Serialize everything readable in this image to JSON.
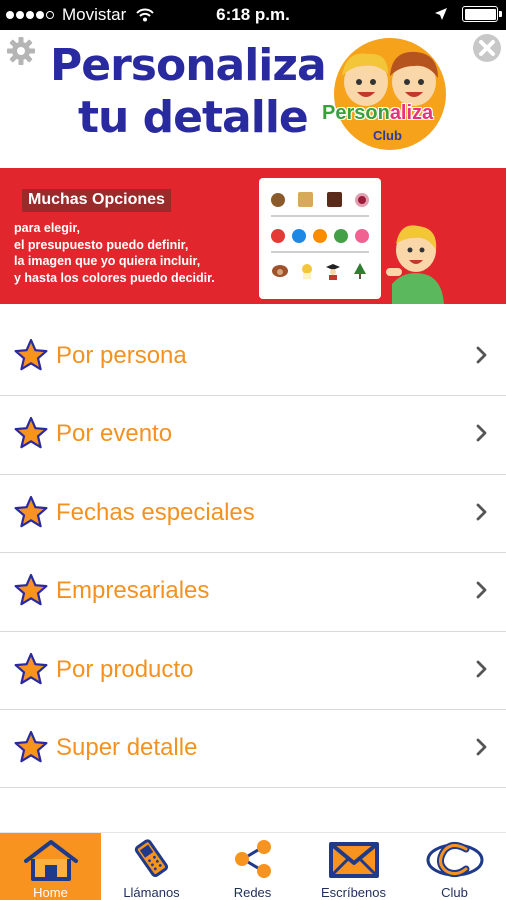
{
  "status_bar": {
    "carrier": "Movistar",
    "time": "6:18 p.m.",
    "signal_bars_filled": 4,
    "signal_bars_total": 5
  },
  "header": {
    "title_line1": "Personaliza",
    "title_line2": "tu detalle",
    "logo_text_part1": "Person",
    "logo_text_part2": "aliza",
    "logo_club": "Club",
    "gear_icon": "gear-icon",
    "close_icon": "close-icon"
  },
  "banner": {
    "label": "Muchas Opciones",
    "lines": [
      "para elegir,",
      "el presupuesto puedo definir,",
      "la imagen que yo quiera incluir,",
      "y hasta los colores puedo decidir."
    ],
    "card_colors": [
      "#e53935",
      "#1e88e5",
      "#fb8c00",
      "#43a047",
      "#f06292"
    ]
  },
  "menu": {
    "items": [
      {
        "label": "Por persona"
      },
      {
        "label": "Por evento"
      },
      {
        "label": "Fechas especiales"
      },
      {
        "label": "Empresariales"
      },
      {
        "label": "Por producto"
      },
      {
        "label": "Super detalle"
      }
    ],
    "icon": "star-icon",
    "chevron_icon": "chevron-right-icon"
  },
  "tabbar": {
    "tabs": [
      {
        "label": "Home",
        "icon": "home-icon",
        "active": true
      },
      {
        "label": "Llámanos",
        "icon": "phone-icon",
        "active": false
      },
      {
        "label": "Redes",
        "icon": "share-icon",
        "active": false
      },
      {
        "label": "Escríbenos",
        "icon": "envelope-icon",
        "active": false
      },
      {
        "label": "Club",
        "icon": "club-icon",
        "active": false
      }
    ]
  },
  "colors": {
    "accent_orange": "#f39220",
    "banner_red": "#e2262d",
    "title_blue": "#2a2aa0",
    "tab_active": "#f7931e"
  }
}
